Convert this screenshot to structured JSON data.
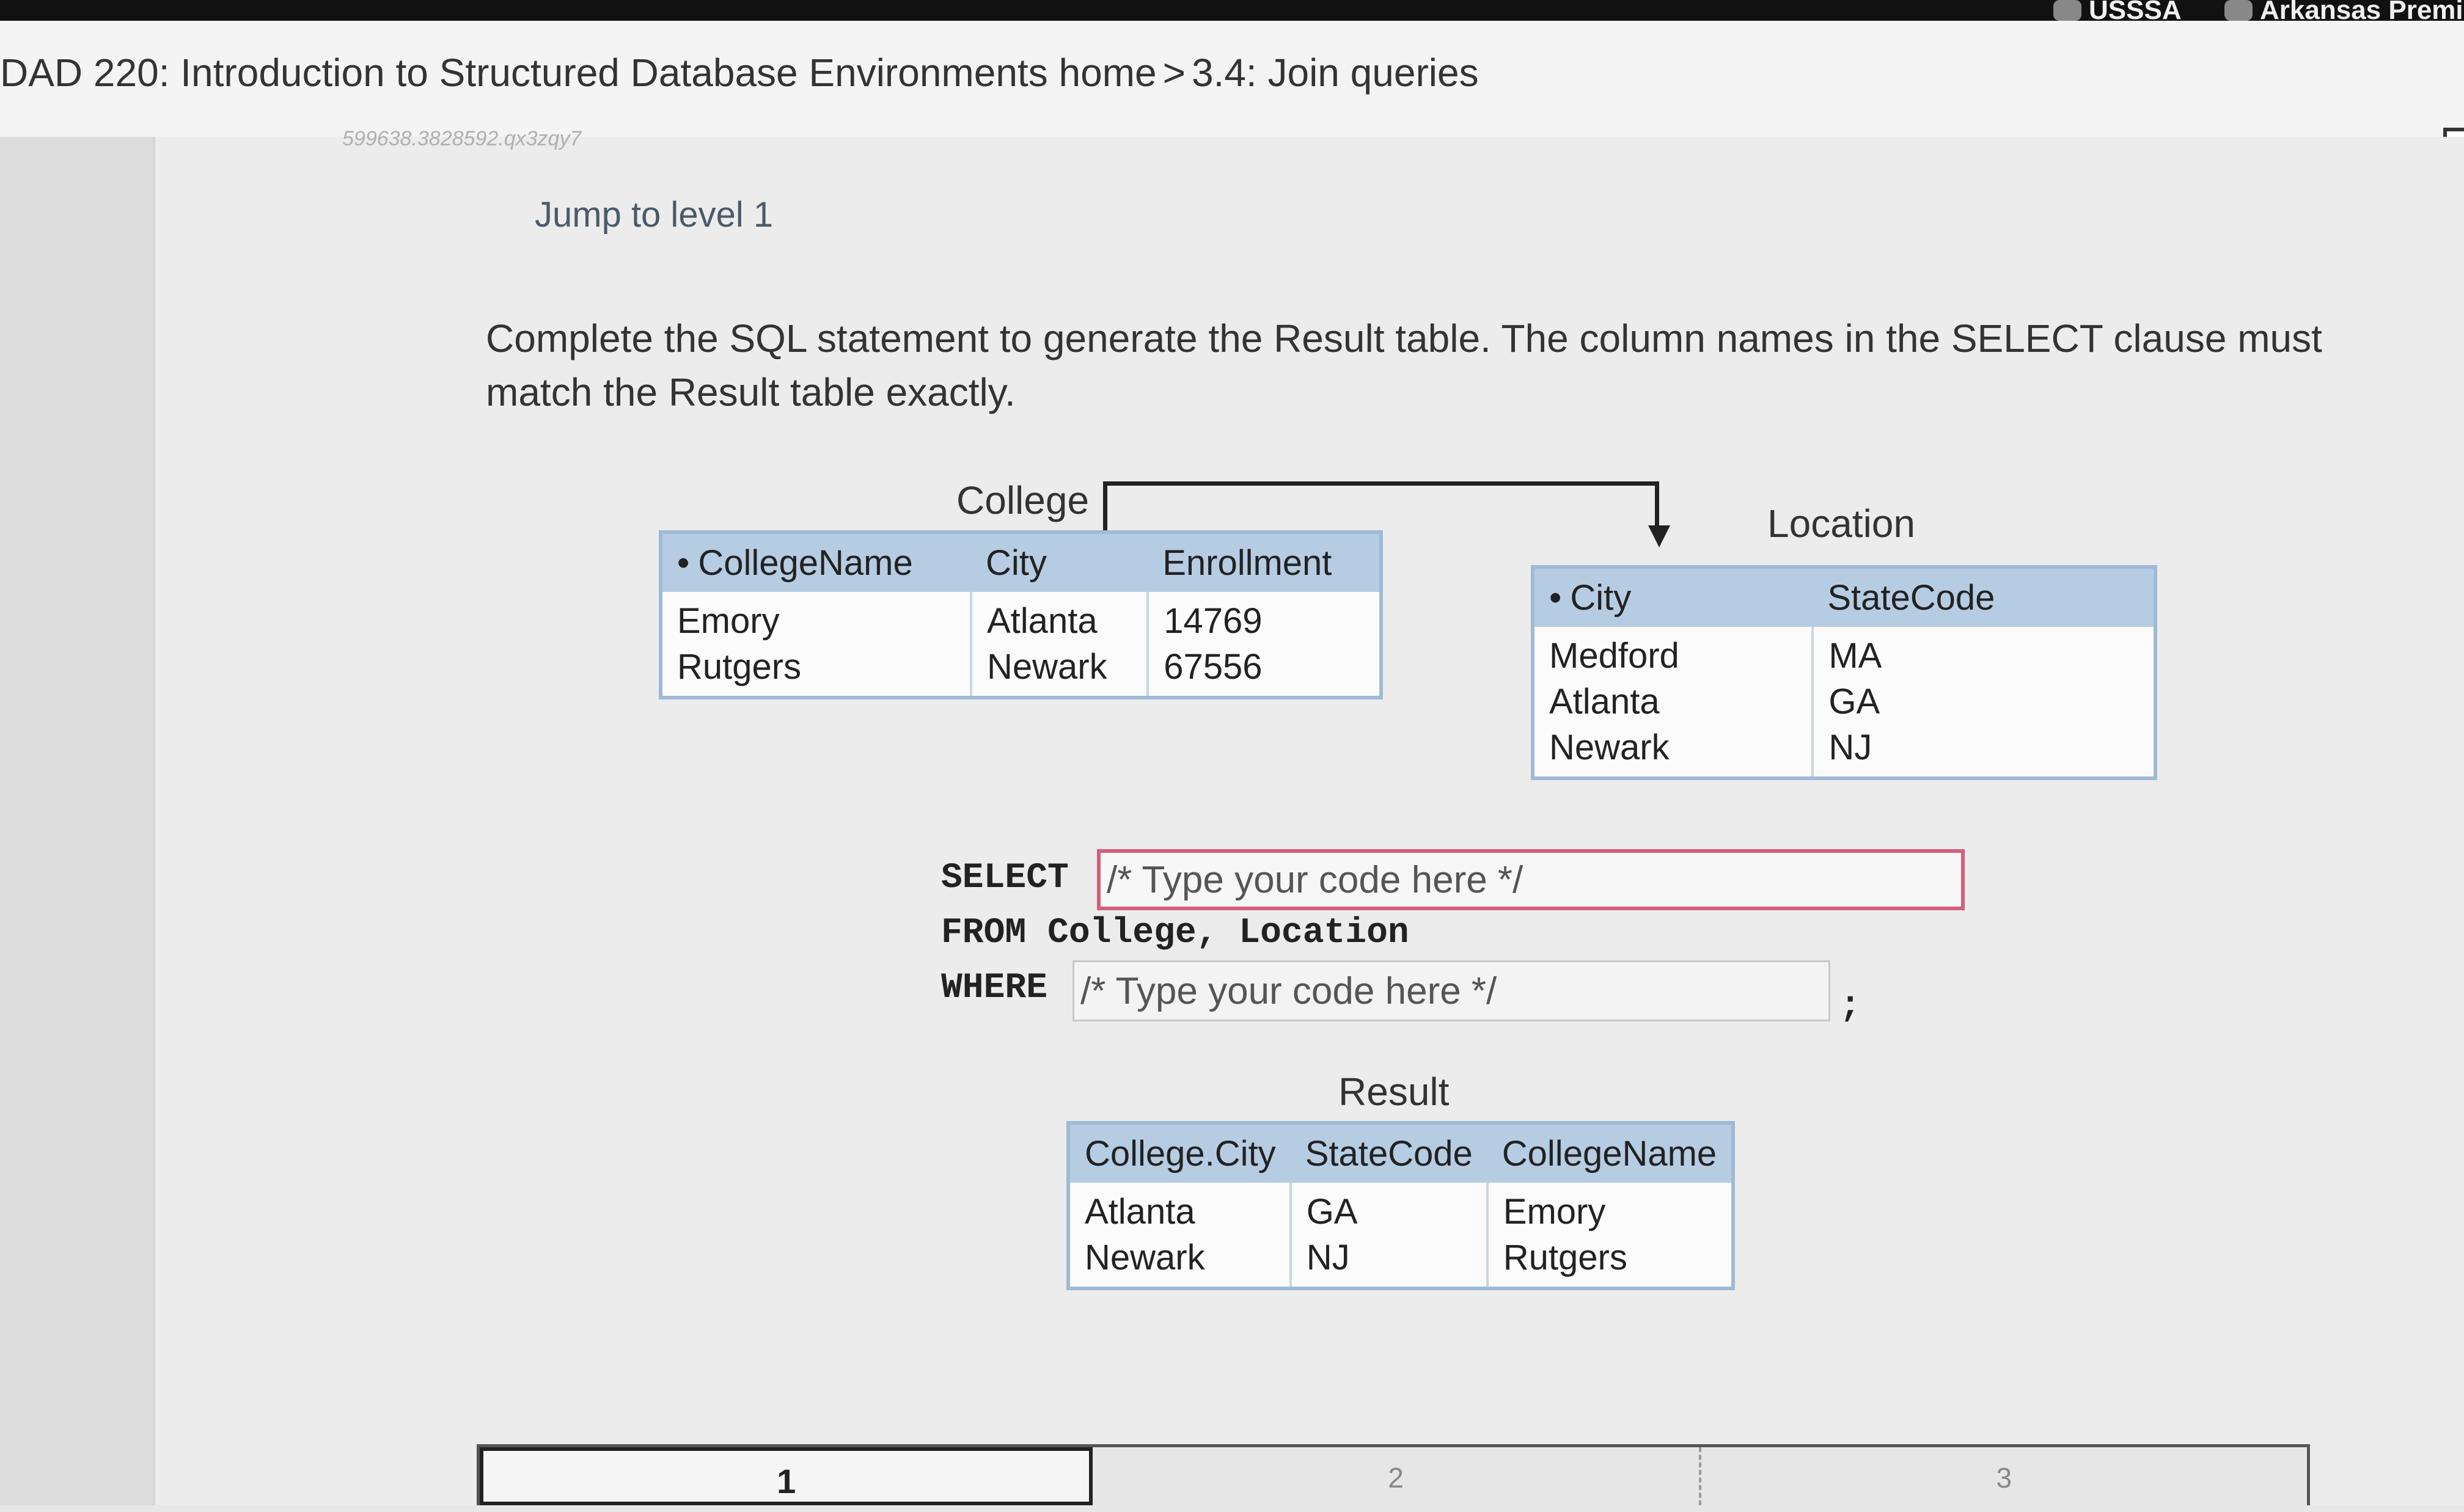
{
  "browser": {
    "bookmarks": [
      {
        "label": "USSSA",
        "icon": "ussa-icon"
      },
      {
        "label": "Arkansas Premie",
        "icon": "bookmark-icon"
      }
    ]
  },
  "header": {
    "course": "DAD 220: Introduction to Structured Database Environments home",
    "separator": ">",
    "section": "3.4: Join queries"
  },
  "activity": {
    "id": "599638.3828592.qx3zqy7",
    "jump_label": "Jump to level 1",
    "instructions": "Complete the SQL statement to generate the Result table. The column names in the SELECT clause must match the Result table exactly."
  },
  "college_table": {
    "caption": "College",
    "columns": [
      "CollegeName",
      "City",
      "Enrollment"
    ],
    "rows": [
      [
        "Emory",
        "Atlanta",
        "14769"
      ],
      [
        "Rutgers",
        "Newark",
        "67556"
      ]
    ]
  },
  "location_table": {
    "caption": "Location",
    "columns": [
      "City",
      "StateCode"
    ],
    "rows": [
      [
        "Medford",
        "MA"
      ],
      [
        "Atlanta",
        "GA"
      ],
      [
        "Newark",
        "NJ"
      ]
    ]
  },
  "sql": {
    "select_kw": "SELECT",
    "from_line": "FROM College, Location",
    "where_kw": "WHERE",
    "select_placeholder": "/* Type your code here */",
    "where_placeholder": "/* Type your code here */",
    "terminator": ";"
  },
  "result_table": {
    "caption": "Result",
    "columns": [
      "College.City",
      "StateCode",
      "CollegeName"
    ],
    "rows": [
      [
        "Atlanta",
        "GA",
        "Emory"
      ],
      [
        "Newark",
        "NJ",
        "Rutgers"
      ]
    ]
  },
  "levels": [
    "1",
    "2",
    "3"
  ]
}
